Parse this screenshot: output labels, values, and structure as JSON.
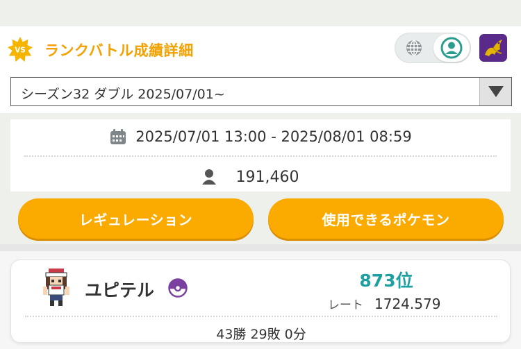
{
  "header": {
    "title": "ランクバトル成績詳細",
    "vs_badge": "VS",
    "icons": [
      "vs-badge-icon",
      "globe-icon",
      "user-circle-icon",
      "dragon-avatar-icon"
    ]
  },
  "season": {
    "selected": "シーズン32 ダブル 2025/07/01~"
  },
  "info": {
    "period": "2025/07/01 13:00 - 2025/08/01 08:59",
    "players": "191,460"
  },
  "buttons": {
    "regulation": "レギュレーション",
    "usable_pokemon": "使用できるポケモン"
  },
  "player": {
    "name": "ユピテル",
    "rank": "873位",
    "rate_label": "レート",
    "rate_value": "1724.579",
    "record": "43勝 29敗 0分"
  },
  "colors": {
    "accent_orange": "#fbab00",
    "title_orange": "#f3a100",
    "rank_teal": "#1ea0a0",
    "toggle_green": "#2a9d8f",
    "ball_purple": "#7b3fa0"
  }
}
